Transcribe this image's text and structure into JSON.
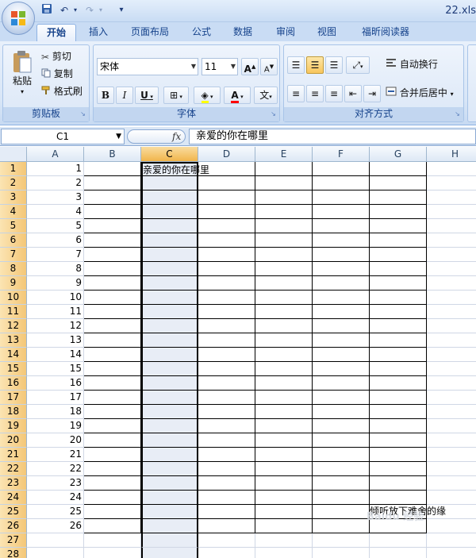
{
  "window": {
    "title": "22.xls"
  },
  "quick_access": {
    "save": "save-icon",
    "undo": "undo-icon",
    "redo": "redo-icon",
    "customize": "▾"
  },
  "tabs": [
    "开始",
    "插入",
    "页面布局",
    "公式",
    "数据",
    "审阅",
    "视图",
    "福昕阅读器"
  ],
  "ribbon": {
    "clipboard": {
      "paste": "粘贴",
      "cut": "剪切",
      "copy": "复制",
      "format_painter": "格式刷",
      "label": "剪贴板"
    },
    "font": {
      "name": "宋体",
      "size": "11",
      "bold": "B",
      "italic": "I",
      "underline": "U",
      "font_color": "A",
      "phonetic": "文",
      "label": "字体"
    },
    "alignment": {
      "wrap_text": "自动换行",
      "merge_center": "合并后居中",
      "label": "对齐方式"
    }
  },
  "formula_bar": {
    "name_box": "C1",
    "fx": "fx",
    "content": "亲爱的你在哪里"
  },
  "columns": [
    "A",
    "B",
    "C",
    "D",
    "E",
    "F",
    "G",
    "H"
  ],
  "selected_column": "C",
  "rows": [
    "1",
    "2",
    "3",
    "4",
    "5",
    "6",
    "7",
    "8",
    "9",
    "10",
    "11",
    "12",
    "13",
    "14",
    "15",
    "16",
    "17",
    "18",
    "19",
    "20",
    "21",
    "22",
    "23",
    "24",
    "25",
    "26",
    "27",
    "28"
  ],
  "column_a_values": [
    "1",
    "2",
    "3",
    "4",
    "5",
    "6",
    "7",
    "8",
    "9",
    "10",
    "11",
    "12",
    "13",
    "14",
    "15",
    "16",
    "17",
    "18",
    "19",
    "20",
    "21",
    "22",
    "23",
    "24",
    "25",
    "26"
  ],
  "cells": {
    "C1": "亲爱的你在哪里",
    "G25": "倾听放下难舍的缘"
  },
  "watermark": "Baidu 经验"
}
